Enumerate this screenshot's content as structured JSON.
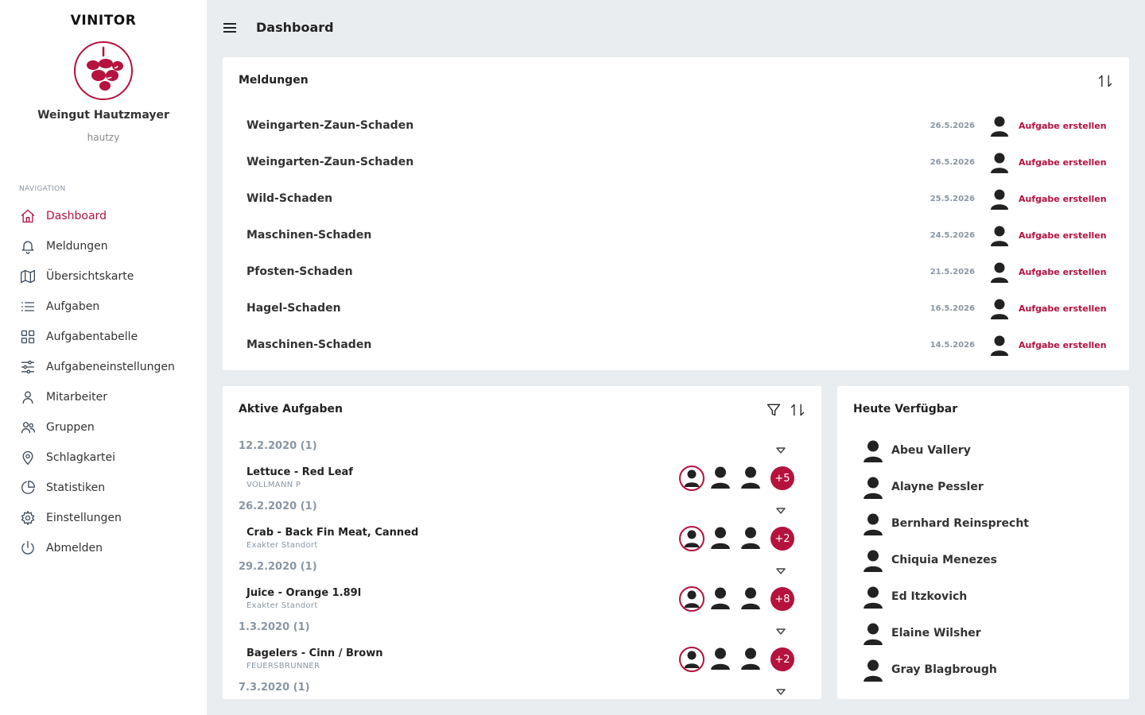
{
  "app": {
    "brand": "VINITOR",
    "org_name": "Weingut Hautzmayer",
    "org_user": "hautzy",
    "accent_color": "#b5123e"
  },
  "sidebar": {
    "heading": "NAVIGATION",
    "items": [
      {
        "label": "Dashboard",
        "icon": "home-icon",
        "active": true
      },
      {
        "label": "Meldungen",
        "icon": "bell-icon"
      },
      {
        "label": "Übersichtskarte",
        "icon": "map-icon"
      },
      {
        "label": "Aufgaben",
        "icon": "list-icon"
      },
      {
        "label": "Aufgabentabelle",
        "icon": "grid-icon"
      },
      {
        "label": "Aufgabeneinstellungen",
        "icon": "sliders-icon"
      },
      {
        "label": "Mitarbeiter",
        "icon": "user-icon"
      },
      {
        "label": "Gruppen",
        "icon": "users-icon"
      },
      {
        "label": "Schlagkartei",
        "icon": "map-pin-icon"
      },
      {
        "label": "Statistiken",
        "icon": "pie-chart-icon"
      },
      {
        "label": "Einstellungen",
        "icon": "gear-icon"
      },
      {
        "label": "Abmelden",
        "icon": "power-icon"
      }
    ]
  },
  "header": {
    "title": "Dashboard"
  },
  "meldungen": {
    "title": "Meldungen",
    "action_label": "Aufgabe erstellen",
    "rows": [
      {
        "title": "Weingarten-Zaun-Schaden",
        "date": "26.5.2026"
      },
      {
        "title": "Weingarten-Zaun-Schaden",
        "date": "26.5.2026"
      },
      {
        "title": "Wild-Schaden",
        "date": "25.5.2026"
      },
      {
        "title": "Maschinen-Schaden",
        "date": "24.5.2026"
      },
      {
        "title": "Pfosten-Schaden",
        "date": "21.5.2026"
      },
      {
        "title": "Hagel-Schaden",
        "date": "16.5.2026"
      },
      {
        "title": "Maschinen-Schaden",
        "date": "14.5.2026"
      }
    ]
  },
  "aufgaben": {
    "title": "Aktive Aufgaben",
    "groups": [
      {
        "date": "12.2.2020 (1)",
        "task": {
          "title": "Lettuce - Red Leaf",
          "sub": "VOLLMANN P",
          "more": "+5"
        }
      },
      {
        "date": "26.2.2020 (1)",
        "task": {
          "title": "Crab - Back Fin Meat, Canned",
          "sub": "Exakter Standort",
          "more": "+2"
        }
      },
      {
        "date": "29.2.2020 (1)",
        "task": {
          "title": "Juice - Orange 1.89l",
          "sub": "Exakter Standort",
          "more": "+8"
        }
      },
      {
        "date": "1.3.2020 (1)",
        "task": {
          "title": "Bagelers - Cinn / Brown",
          "sub": "FEUERSBRUNNER",
          "more": "+2"
        }
      },
      {
        "date": "7.3.2020 (1)",
        "task": null
      }
    ]
  },
  "verfuegbar": {
    "title": "Heute Verfügbar",
    "people": [
      "Abeu Vallery",
      "Alayne Pessler",
      "Bernhard Reinsprecht",
      "Chiquia Menezes",
      "Ed Itzkovich",
      "Elaine Wilsher",
      "Gray Blagbrough"
    ]
  }
}
